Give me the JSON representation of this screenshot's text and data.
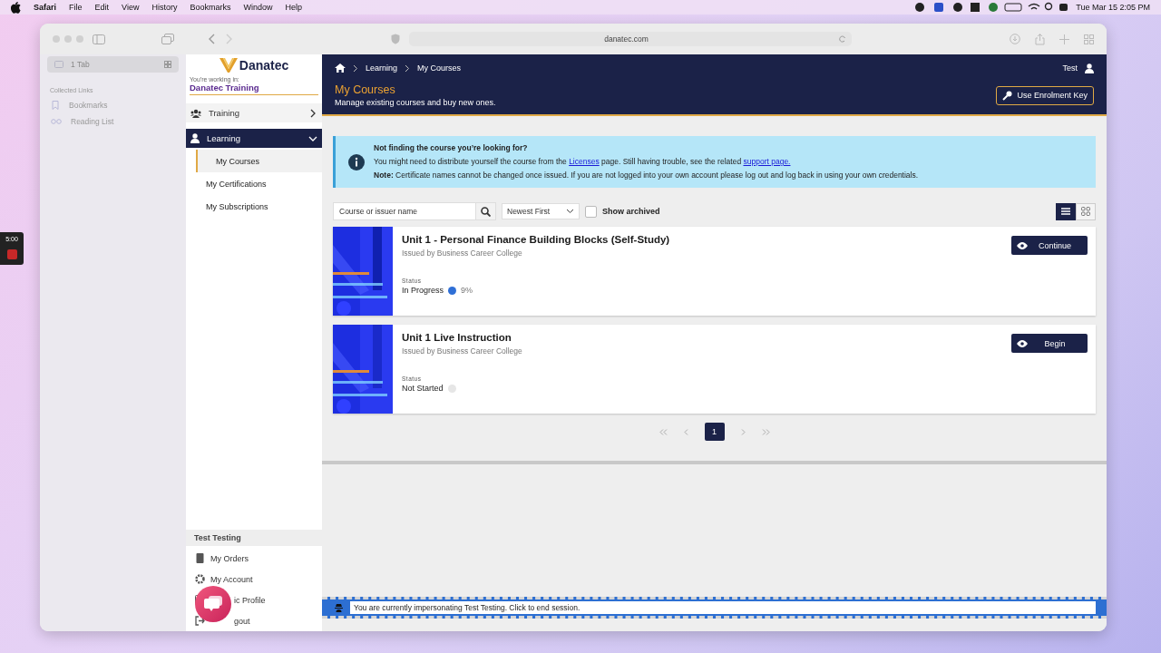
{
  "menubar": {
    "app": "Safari",
    "menus": [
      "File",
      "Edit",
      "View",
      "History",
      "Bookmarks",
      "Window",
      "Help"
    ],
    "clock": "Tue Mar 15  2:05 PM"
  },
  "recorder": {
    "time": "5:00"
  },
  "browser": {
    "address": "danatec.com",
    "tab_group": "1 Tab",
    "section": "Collected Links",
    "links": [
      "Bookmarks",
      "Reading List"
    ]
  },
  "nav": {
    "brand": "Danatec",
    "context_label": "You're working in:",
    "context": "Danatec Training",
    "items": [
      {
        "label": "Training",
        "expanded": false,
        "selected": false
      },
      {
        "label": "Learning",
        "expanded": true,
        "selected": true,
        "children": [
          {
            "label": "My Courses",
            "selected": true
          },
          {
            "label": "My Certifications",
            "selected": false
          },
          {
            "label": "My Subscriptions",
            "selected": false
          }
        ]
      }
    ],
    "user_name": "Test Testing",
    "user_items": [
      {
        "kind": "orders",
        "label": "My Orders"
      },
      {
        "kind": "account",
        "label": "My Account"
      },
      {
        "kind": "profile",
        "label": "ic Profile"
      },
      {
        "kind": "logout",
        "label": "gout"
      }
    ]
  },
  "breadcrumb": [
    "Learning",
    "My Courses"
  ],
  "user": "Test",
  "header": {
    "title": "My Courses",
    "subtitle": "Manage existing courses and buy new ones.",
    "action": "Use Enrolment Key"
  },
  "notice": {
    "title": "Not finding the course you’re looking for?",
    "parts": [
      {
        "text": "You might need to distribute yourself the course from the "
      },
      {
        "text": "Licenses",
        "link": true
      },
      {
        "text": " page. Still having trouble, see the related "
      },
      {
        "text": "support page.",
        "link": true
      }
    ],
    "note": "**Note:** Certificate names cannot be changed once issued. If you are not logged into your own account please log out and log back in using your own credentials."
  },
  "toolbar": {
    "search_placeholder": "Course or issuer name",
    "sort": "Newest First",
    "archived": {
      "label": "Show archived",
      "checked": false
    },
    "views": [
      {
        "kind": "list",
        "selected": true
      },
      {
        "kind": "grid",
        "selected": false
      }
    ]
  },
  "courses": [
    {
      "title": "Unit 1 - Personal Finance Building Blocks (Self-Study)",
      "issuer": "Issued by Business Career College",
      "status_label": "Status",
      "status": "In Progress",
      "color": "#2f6fd6",
      "progress": "9%",
      "action": "Continue"
    },
    {
      "title": "Unit 1 Live Instruction",
      "issuer": "Issued by Business Career College",
      "status_label": "Status",
      "status": "Not Started",
      "color": "#e6e6e6",
      "action": "Begin"
    }
  ],
  "pagination": {
    "pages": [
      {
        "label": "1",
        "selected": true
      }
    ]
  },
  "impersonation": "You are currently impersonating Test Testing. Click to end session."
}
